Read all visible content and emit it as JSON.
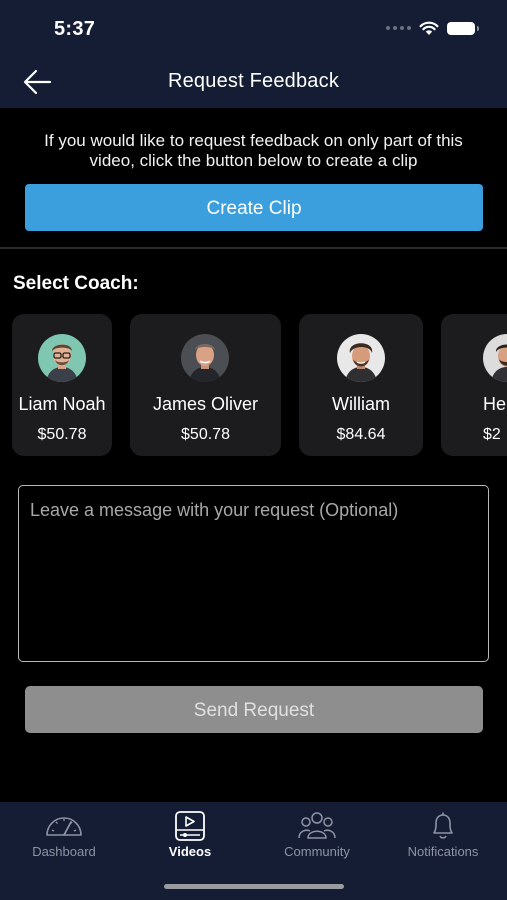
{
  "status": {
    "time": "5:37"
  },
  "header": {
    "title": "Request Feedback"
  },
  "intro": {
    "text": "If you would like to request feedback on only part of this video, click the button below to create a clip",
    "create_clip_label": "Create Clip"
  },
  "coaches": {
    "label": "Select Coach:",
    "items": [
      {
        "name": "Liam Noah",
        "price": "$50.78"
      },
      {
        "name": "James Oliver",
        "price": "$50.78"
      },
      {
        "name": "William",
        "price": "$84.64"
      },
      {
        "name": "He",
        "price": "$2"
      }
    ]
  },
  "message": {
    "placeholder": "Leave a message with your request (Optional)",
    "value": ""
  },
  "send_label": "Send Request",
  "tabs": [
    {
      "label": "Dashboard",
      "icon": "gauge-icon",
      "active": false
    },
    {
      "label": "Videos",
      "icon": "video-icon",
      "active": true
    },
    {
      "label": "Community",
      "icon": "group-icon",
      "active": false
    },
    {
      "label": "Notifications",
      "icon": "bell-icon",
      "active": false
    }
  ],
  "colors": {
    "header_bg": "#141d33",
    "accent": "#3a9fdc",
    "disabled_button": "#8e8e8e",
    "card_bg": "#1c1c1e"
  }
}
